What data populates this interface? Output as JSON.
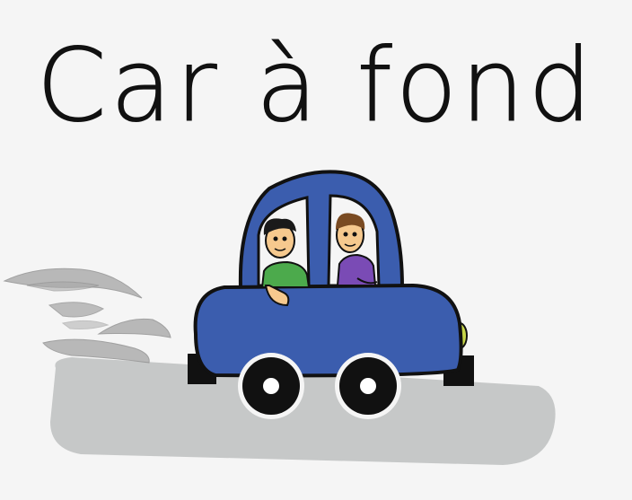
{
  "title": "Car à fond",
  "colors": {
    "background": "#f5f5f5",
    "car_body": "#3b5dae",
    "outline": "#111111",
    "road": "#c6c8c8",
    "smoke": "#a9a9a9",
    "shirt_left": "#4caa4c",
    "shirt_right": "#7a4bb5",
    "skin": "#f6c98e",
    "headlight": "#c7d64a"
  },
  "icons": [
    "car-icon",
    "smoke-icon",
    "road-icon"
  ]
}
